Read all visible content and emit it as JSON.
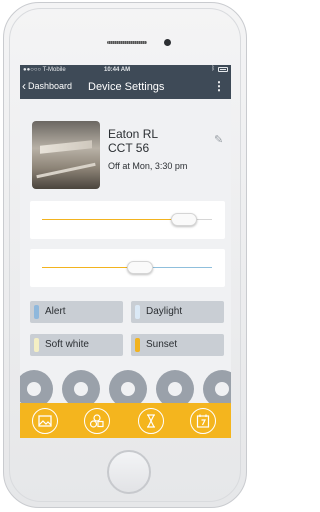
{
  "status_bar": {
    "carrier": "●●○○○ T-Mobile",
    "time": "10:44 AM",
    "bluetooth": "bluetooth-icon",
    "battery": "battery-icon"
  },
  "nav": {
    "back_label": "Dashboard",
    "title": "Device Settings",
    "more_icon": "more-vertical-icon"
  },
  "device": {
    "name": "Eaton RL",
    "model": "CCT 56",
    "status": "Off at Mon, 3:30 pm",
    "edit_icon": "pencil-icon"
  },
  "sliders": [
    {
      "name": "brightness",
      "value": 0.91
    },
    {
      "name": "color-temperature",
      "value": 0.59
    }
  ],
  "presets": [
    {
      "label": "Alert",
      "color": "#8fb8dc"
    },
    {
      "label": "Daylight",
      "color": "#dbe9f6"
    },
    {
      "label": "Soft white",
      "color": "#f4efc4"
    },
    {
      "label": "Sunset",
      "color": "#f2b31f"
    }
  ],
  "bottom_tabs": [
    {
      "icon": "scene-icon"
    },
    {
      "icon": "group-icon"
    },
    {
      "icon": "hourglass-icon"
    },
    {
      "icon": "calendar-icon"
    }
  ],
  "colors": {
    "accent": "#f4b51e",
    "nav": "#3e4a57",
    "slider_fill": "#f2b31f",
    "slider_cool": "#8fbfdc"
  }
}
